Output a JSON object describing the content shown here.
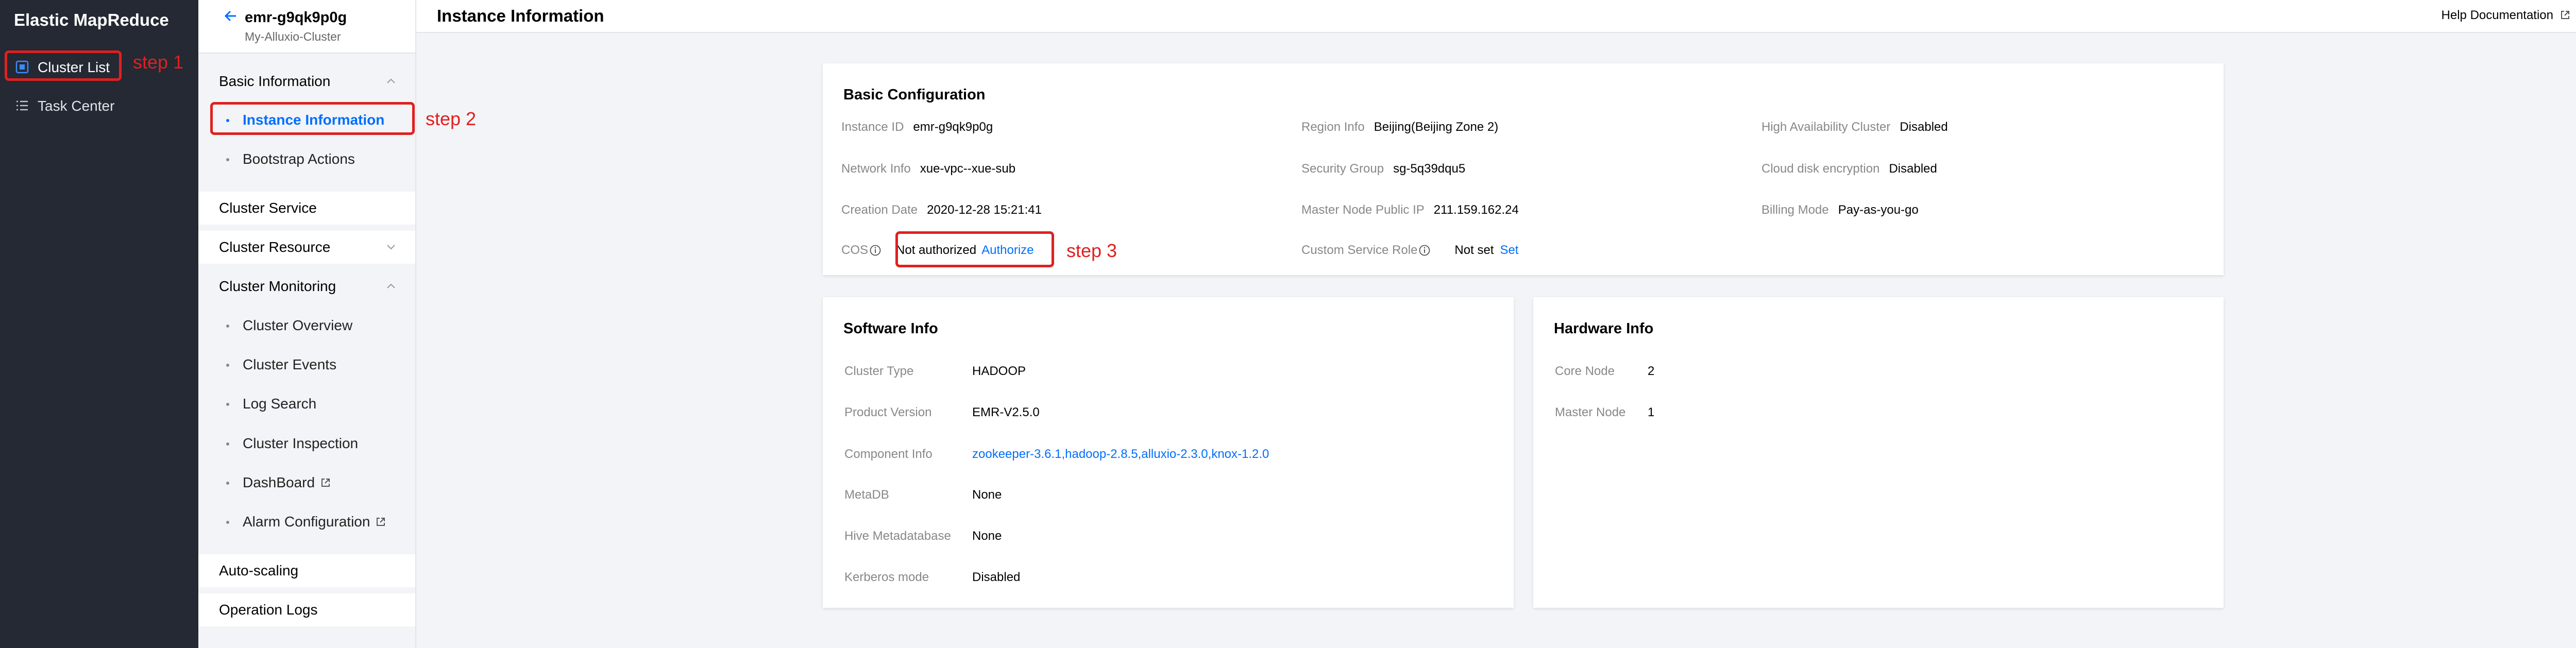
{
  "app": {
    "title": "Elastic MapReduce"
  },
  "nav": [
    {
      "label": "Cluster List",
      "icon": "cluster-list-icon"
    },
    {
      "label": "Task Center",
      "icon": "task-list-icon"
    }
  ],
  "submenu": {
    "cluster_id": "emr-g9qk9p0g",
    "cluster_name": "My-Alluxio-Cluster",
    "basic_information": "Basic Information",
    "instance_information": "Instance Information",
    "bootstrap_actions": "Bootstrap Actions",
    "cluster_service": "Cluster Service",
    "cluster_resource": "Cluster Resource",
    "cluster_monitoring": "Cluster Monitoring",
    "cluster_overview": "Cluster Overview",
    "cluster_events": "Cluster Events",
    "log_search": "Log Search",
    "cluster_inspection": "Cluster Inspection",
    "dashboard": "DashBoard",
    "alarm_configuration": "Alarm Configuration",
    "auto_scaling": "Auto-scaling",
    "operation_logs": "Operation Logs"
  },
  "header": {
    "title": "Instance Information",
    "help": "Help Documentation"
  },
  "basic": {
    "title": "Basic Configuration",
    "instance_id_label": "Instance ID",
    "instance_id": "emr-g9qk9p0g",
    "network_label": "Network Info",
    "network": "xue-vpc--xue-sub",
    "creation_label": "Creation Date",
    "creation": "2020-12-28 15:21:41",
    "cos_label": "COS",
    "cos_status": "Not authorized",
    "cos_action": "Authorize",
    "region_label": "Region Info",
    "region": "Beijing(Beijing Zone 2)",
    "security_label": "Security Group",
    "security": "sg-5q39dqu5",
    "master_ip_label": "Master Node Public IP",
    "master_ip": "211.159.162.24",
    "service_role_label": "Custom Service Role",
    "service_role_status": "Not set",
    "service_role_action": "Set",
    "ha_label": "High Availability Cluster",
    "ha": "Disabled",
    "disk_label": "Cloud disk encryption",
    "disk": "Disabled",
    "billing_label": "Billing Mode",
    "billing": "Pay-as-you-go"
  },
  "software": {
    "title": "Software Info",
    "type_label": "Cluster Type",
    "type": "HADOOP",
    "version_label": "Product Version",
    "version": "EMR-V2.5.0",
    "component_label": "Component Info",
    "component": "zookeeper-3.6.1,hadoop-2.8.5,alluxio-2.3.0,knox-1.2.0",
    "metadb_label": "MetaDB",
    "metadb": "None",
    "hive_label": "Hive Metadatabase",
    "hive": "None",
    "kerberos_label": "Kerberos mode",
    "kerberos": "Disabled"
  },
  "hardware": {
    "title": "Hardware Info",
    "core_label": "Core Node",
    "core": "2",
    "master_label": "Master Node",
    "master": "1"
  },
  "annotations": {
    "step1": "step 1",
    "step2": "step 2",
    "step3": "step 3"
  },
  "colors": {
    "accent": "#006eff",
    "sidebar": "#242933",
    "annotation": "#e02020"
  }
}
